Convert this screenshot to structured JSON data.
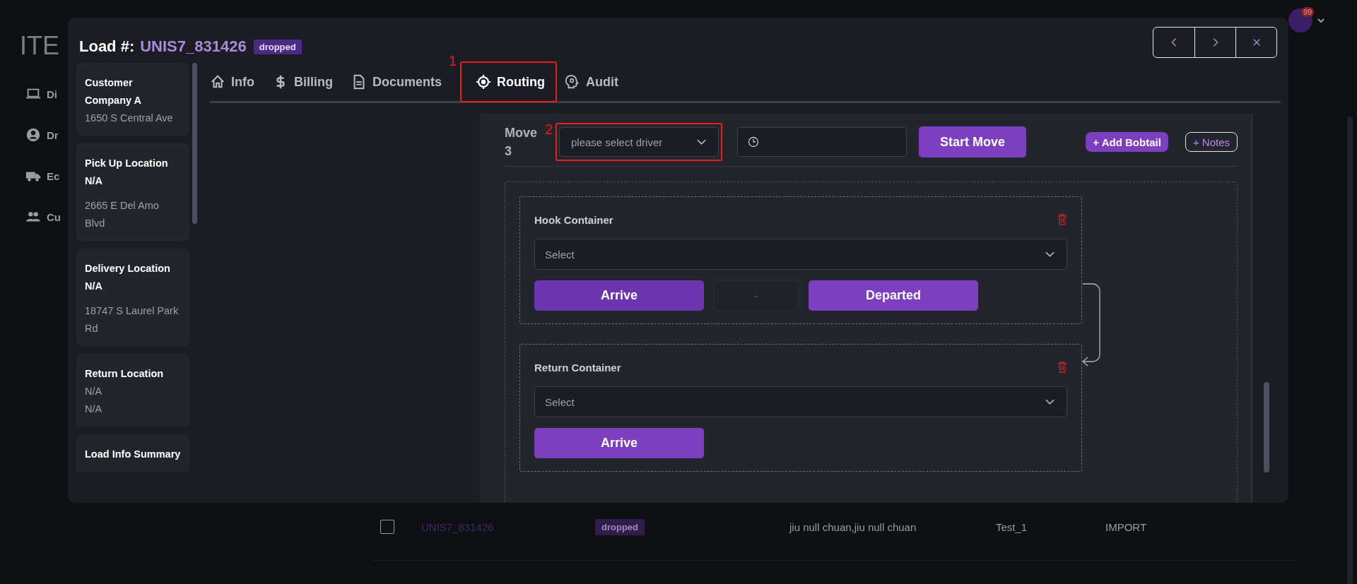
{
  "background_page": {
    "title": "ITE",
    "nav": [
      {
        "label": "Di",
        "kind": "laptop"
      },
      {
        "label": "Dr",
        "kind": "person"
      },
      {
        "label": "Ec",
        "kind": "truck"
      },
      {
        "label": "Cu",
        "kind": "people"
      }
    ],
    "notification_count": "99",
    "table_row": {
      "checked": false,
      "load": "UNIS7_831426",
      "status": "dropped",
      "cells": [
        "jiu null chuan,jiu null chuan",
        "Test_1",
        "IMPORT"
      ]
    }
  },
  "modal": {
    "load_label": "Load #:",
    "load_number": "UNIS7_831426",
    "status": "dropped",
    "summary_cards": [
      {
        "title": "Customer Company A",
        "lines": [
          "1650 S Central Ave"
        ]
      },
      {
        "title": "Pick Up Location",
        "name": "N/A",
        "lines": [
          "2665 E Del Amo Blvd"
        ]
      },
      {
        "title": "Delivery Location",
        "name": "N/A",
        "lines": [
          "18747 S Laurel Park Rd"
        ]
      },
      {
        "title": "Return Location",
        "lines": [
          "N/A",
          "N/A"
        ]
      },
      {
        "title": "Load Info Summary"
      }
    ],
    "tabs": [
      {
        "label": "Info",
        "kind": "home",
        "selected": false
      },
      {
        "label": "Billing",
        "kind": "dollar",
        "selected": false
      },
      {
        "label": "Documents",
        "kind": "document",
        "selected": false
      },
      {
        "label": "Routing",
        "kind": "target",
        "selected": true,
        "annotation": "1"
      },
      {
        "label": "Audit",
        "kind": "head",
        "selected": false
      }
    ],
    "move": {
      "title": "Move",
      "number": "3",
      "driver_placeholder": "please select driver",
      "driver_annotation": "2",
      "start_button": "Start Move",
      "add_bobtail": "+ Add Bobtail",
      "notes": "+ Notes"
    },
    "events": [
      {
        "kind": "hook",
        "title": "Hook Container",
        "select_placeholder": "Select",
        "arrive": "Arrive",
        "time": "-",
        "departed": "Departed"
      },
      {
        "kind": "return",
        "title": "Return Container",
        "select_placeholder": "Select",
        "arrive": "Arrive"
      }
    ]
  }
}
